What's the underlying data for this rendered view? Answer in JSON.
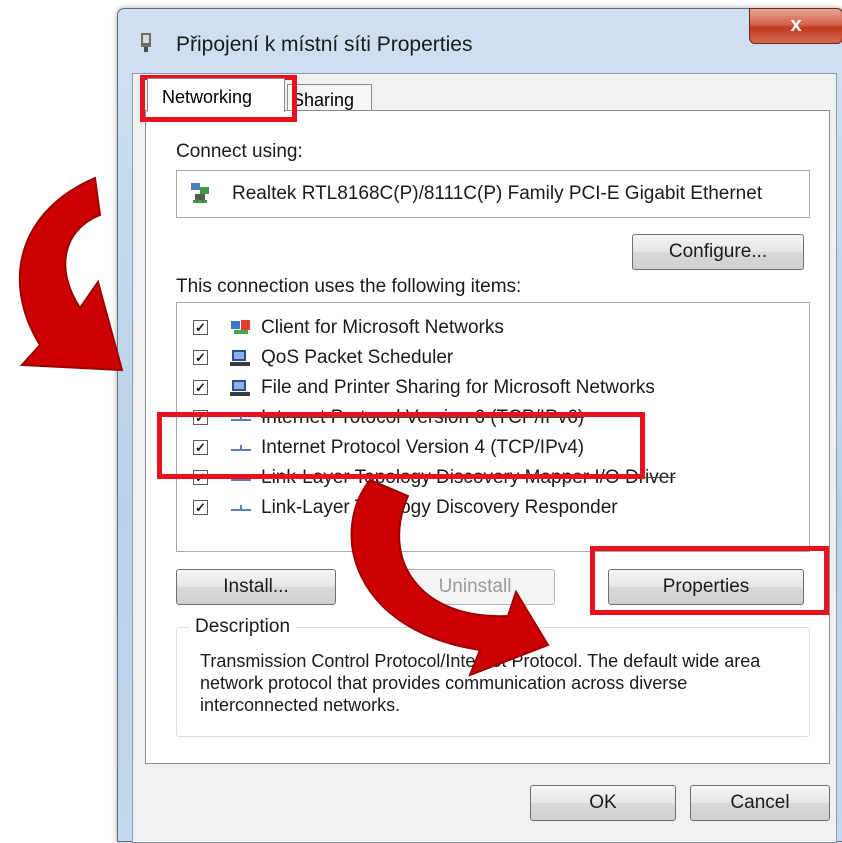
{
  "window": {
    "title": "Připojení k místní síti Properties",
    "close_glyph": "x"
  },
  "tabs": [
    {
      "label": "Networking",
      "active": true
    },
    {
      "label": "Sharing",
      "active": false
    }
  ],
  "connect_using": {
    "label": "Connect using:",
    "adapter": "Realtek RTL8168C(P)/8111C(P) Family PCI-E Gigabit Ethernet",
    "adapter_icon": "network-adapter-icon",
    "configure_label": "Configure..."
  },
  "items_section": {
    "label": "This connection uses the following items:",
    "items": [
      {
        "label": "Client for Microsoft Networks",
        "checked": true,
        "icon": "client-network-icon"
      },
      {
        "label": "QoS Packet Scheduler",
        "checked": true,
        "icon": "service-icon"
      },
      {
        "label": "File and Printer Sharing for Microsoft Networks",
        "checked": true,
        "icon": "service-icon"
      },
      {
        "label": "Internet Protocol Version 6 (TCP/IPv6)",
        "checked": true,
        "icon": "protocol-icon"
      },
      {
        "label": "Internet Protocol Version 4 (TCP/IPv4)",
        "checked": true,
        "icon": "protocol-icon"
      },
      {
        "label": "Link-Layer Topology Discovery Mapper I/O Driver",
        "checked": true,
        "icon": "protocol-icon"
      },
      {
        "label": "Link-Layer Topology Discovery Responder",
        "checked": true,
        "icon": "protocol-icon"
      }
    ]
  },
  "buttons": {
    "install": "Install...",
    "uninstall": "Uninstall",
    "properties": "Properties",
    "ok": "OK",
    "cancel": "Cancel"
  },
  "description": {
    "legend": "Description",
    "text": "Transmission Control Protocol/Internet Protocol. The default wide area network protocol that provides communication across diverse interconnected networks."
  },
  "annotation_colors": {
    "highlight": "#e8121e",
    "arrow": "#cc0000"
  }
}
